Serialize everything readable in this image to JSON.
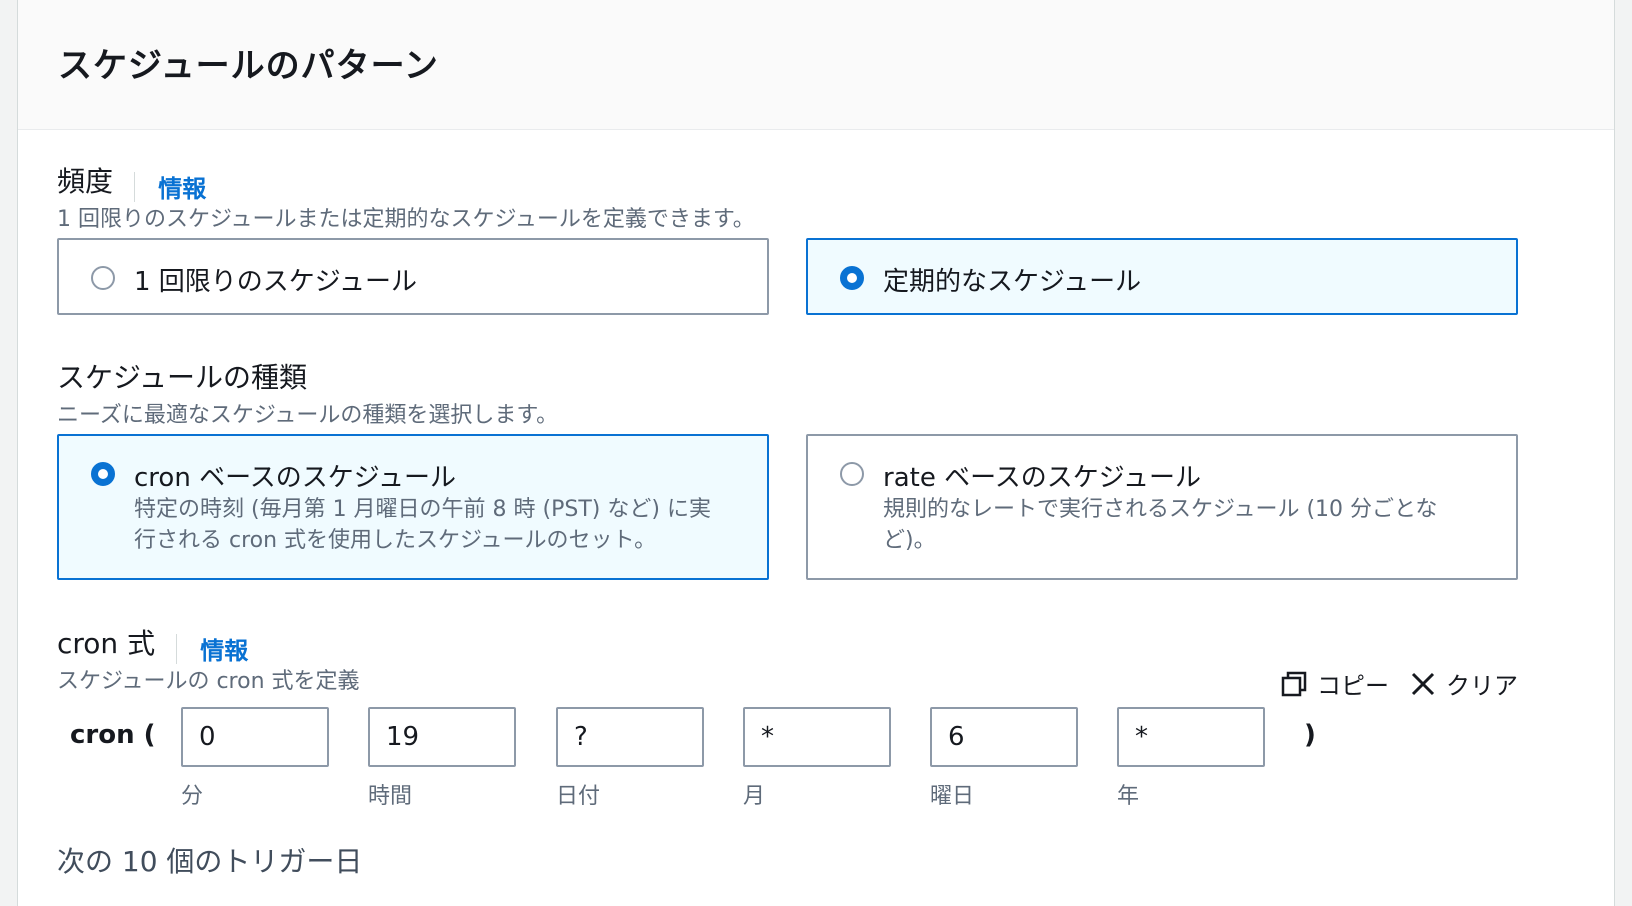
{
  "header": {
    "title": "スケジュールのパターン"
  },
  "frequency": {
    "label": "頻度",
    "info": "情報",
    "description": "1 回限りのスケジュールまたは定期的なスケジュールを定義できます。",
    "options": [
      {
        "label": "1 回限りのスケジュール",
        "selected": false
      },
      {
        "label": "定期的なスケジュール",
        "selected": true
      }
    ]
  },
  "schedule_type": {
    "label": "スケジュールの種類",
    "description": "ニーズに最適なスケジュールの種類を選択します。",
    "options": [
      {
        "label": "cron ベースのスケジュール",
        "desc_line1": "特定の時刻 (毎月第 1 月曜日の午前 8 時 (PST) など) に実",
        "desc_line2": "行される cron 式を使用したスケジュールのセット。",
        "selected": true
      },
      {
        "label": "rate ベースのスケジュール",
        "desc_line1": "規則的なレートで実行されるスケジュール (10 分ごとな",
        "desc_line2": "ど)。",
        "selected": false
      }
    ]
  },
  "cron": {
    "label": "cron 式",
    "info": "情報",
    "description": "スケジュールの cron 式を定義",
    "copy_label": "コピー",
    "clear_label": "クリア",
    "prefix": "cron (",
    "suffix": ")",
    "fields": [
      {
        "value": "0",
        "caption": "分"
      },
      {
        "value": "19",
        "caption": "時間"
      },
      {
        "value": "?",
        "caption": "日付"
      },
      {
        "value": "*",
        "caption": "月"
      },
      {
        "value": "6",
        "caption": "曜日"
      },
      {
        "value": "*",
        "caption": "年"
      }
    ]
  },
  "next_triggers": {
    "label": "次の 10 個のトリガー日"
  },
  "colors": {
    "accent": "#0972d3",
    "selected_bg": "#f0fbff",
    "border": "#8d99a8",
    "muted_text": "#5f6b7a"
  },
  "icons": {
    "copy": "copy-icon",
    "clear": "close-icon"
  }
}
